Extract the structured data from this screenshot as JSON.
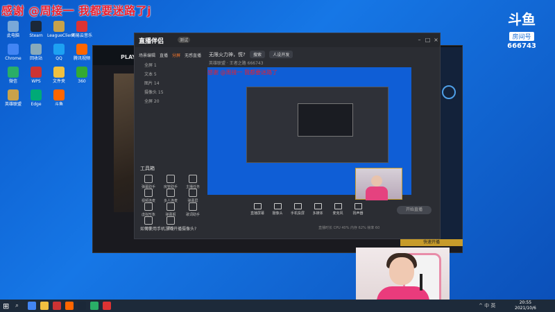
{
  "banner": "感谢 @周接一 我都要迷路了j",
  "douyu": {
    "logo": "斗鱼",
    "sub": "房间号",
    "room": "666743"
  },
  "desktop": {
    "icons": [
      {
        "label": "此电脑",
        "color": "#7aa8d8"
      },
      {
        "label": "Steam",
        "color": "#1b2838"
      },
      {
        "label": "LeagueClient",
        "color": "#c8a24a"
      },
      {
        "label": "网易云音乐",
        "color": "#d33"
      },
      {
        "label": "Chrome",
        "color": "#4285f4"
      },
      {
        "label": "回收站",
        "color": "#8ab"
      },
      {
        "label": "QQ",
        "color": "#1da1f2"
      },
      {
        "label": "腾讯视频",
        "color": "#f60"
      },
      {
        "label": "微信",
        "color": "#2aae67"
      },
      {
        "label": "WPS",
        "color": "#c33"
      },
      {
        "label": "文件夹",
        "color": "#f0c040"
      },
      {
        "label": "360",
        "color": "#3a3"
      },
      {
        "label": "英雄联盟",
        "color": "#c8a24a"
      },
      {
        "label": "Edge",
        "color": "#0a7"
      },
      {
        "label": "斗鱼",
        "color": "#f60"
      }
    ]
  },
  "game": {
    "play_label": "PLAY"
  },
  "app": {
    "title": "直播伴侣",
    "badge": "测试",
    "tabs": [
      "场景编辑",
      "直播",
      "分屏",
      "无感直播"
    ],
    "active_tab": "分屏",
    "sources": [
      "全屏 1",
      "文本 5",
      "图片 14",
      "摄像头 15",
      "全屏 20"
    ],
    "tools_title": "工具箱",
    "tools": [
      "弹幕助手",
      "房管助手",
      "主播任务",
      "视频连麦",
      "多人连麦",
      "弹幕屏",
      "虚拟形象",
      "弹幕姬",
      "歌词助手",
      "音乐",
      "更多"
    ],
    "hint": "如何使用手机游戏开播摄像头?",
    "header_text": "无限火力神，慌?",
    "header_pill1": "搜索",
    "header_pill2": "人设开发",
    "header_sub": "英雄联盟 · 王者之路   666743",
    "preview_text": "感谢 @周接一 我都要迷路了",
    "bottom": [
      "直播屏幕",
      "摄像头",
      "手机投屏",
      "多媒体",
      "麦克风",
      "扬声器"
    ],
    "start": "开始直播",
    "stats": "直播时长  CPU 40%  内存 62%  帧率 60"
  },
  "right": {
    "button": "快速开播"
  },
  "taskbar": {
    "start": "⊞",
    "search": "⌕",
    "tray": "^ 中 英",
    "time": "20:55",
    "date": "2021/10/6"
  }
}
